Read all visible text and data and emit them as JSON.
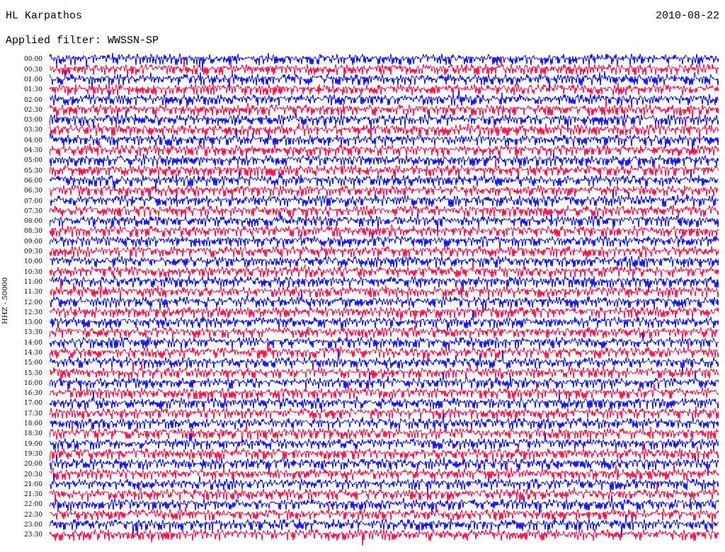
{
  "header": {
    "station": "HL Karpathos",
    "date": "2010-08-22",
    "filter": "Applied filter: WWSSN-SP"
  },
  "channel_label": "HHZ - 50000",
  "rows": [
    {
      "time": "00:00",
      "color": "#0000ff"
    },
    {
      "time": "00:30",
      "color": "#ff0040"
    },
    {
      "time": "01:00",
      "color": "#0000ff"
    },
    {
      "time": "01:30",
      "color": "#ff0040"
    },
    {
      "time": "02:00",
      "color": "#0000ff"
    },
    {
      "time": "02:30",
      "color": "#ff0040"
    },
    {
      "time": "03:00",
      "color": "#0000ff"
    },
    {
      "time": "03:30",
      "color": "#ff0040"
    },
    {
      "time": "04:00",
      "color": "#0000ff"
    },
    {
      "time": "04:30",
      "color": "#ff0040"
    },
    {
      "time": "05:00",
      "color": "#0000ff"
    },
    {
      "time": "05:30",
      "color": "#ff0040"
    },
    {
      "time": "06:00",
      "color": "#0000ff"
    },
    {
      "time": "06:30",
      "color": "#ff0040"
    },
    {
      "time": "07:00",
      "color": "#0000ff"
    },
    {
      "time": "07:30",
      "color": "#ff0040"
    },
    {
      "time": "08:00",
      "color": "#0000ff"
    },
    {
      "time": "08:30",
      "color": "#ff0040"
    },
    {
      "time": "09:00",
      "color": "#0000ff"
    },
    {
      "time": "09:30",
      "color": "#ff0040"
    },
    {
      "time": "10:00",
      "color": "#0000ff"
    },
    {
      "time": "10:30",
      "color": "#ff0040"
    },
    {
      "time": "11:00",
      "color": "#0000ff"
    },
    {
      "time": "11:30",
      "color": "#ff0040"
    },
    {
      "time": "12:00",
      "color": "#0000ff"
    },
    {
      "time": "12:30",
      "color": "#ff0040"
    },
    {
      "time": "13:00",
      "color": "#0000ff"
    },
    {
      "time": "13:30",
      "color": "#ff0040"
    },
    {
      "time": "14:00",
      "color": "#0000ff"
    },
    {
      "time": "14:30",
      "color": "#ff0040"
    },
    {
      "time": "15:00",
      "color": "#0000ff"
    },
    {
      "time": "15:30",
      "color": "#ff0040"
    },
    {
      "time": "16:00",
      "color": "#0000ff"
    },
    {
      "time": "16:30",
      "color": "#ff0040"
    },
    {
      "time": "17:00",
      "color": "#0000ff"
    },
    {
      "time": "17:30",
      "color": "#ff0040"
    },
    {
      "time": "18:00",
      "color": "#0000ff"
    },
    {
      "time": "18:30",
      "color": "#ff0040"
    },
    {
      "time": "19:00",
      "color": "#0000ff"
    },
    {
      "time": "19:30",
      "color": "#ff0040"
    },
    {
      "time": "20:00",
      "color": "#0000ff"
    },
    {
      "time": "20:30",
      "color": "#ff0040"
    },
    {
      "time": "21:00",
      "color": "#0000ff"
    },
    {
      "time": "21:30",
      "color": "#ff0040"
    },
    {
      "time": "22:00",
      "color": "#0000ff"
    },
    {
      "time": "22:30",
      "color": "#ff0040"
    },
    {
      "time": "23:00",
      "color": "#0000ff"
    },
    {
      "time": "23:30",
      "color": "#ff0040"
    }
  ]
}
